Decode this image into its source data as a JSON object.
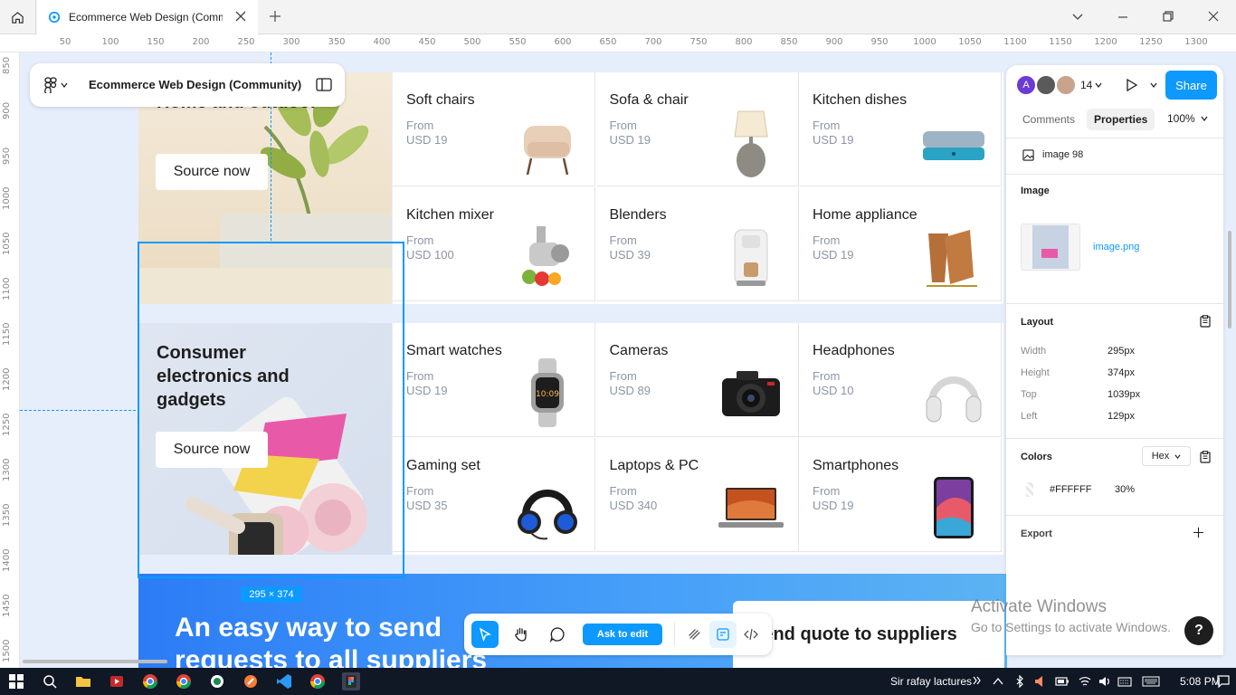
{
  "browser": {
    "tab_title": "Ecommerce Web Design (Community)"
  },
  "ruler_top": [
    "50",
    "100",
    "150",
    "200",
    "250",
    "300",
    "350",
    "400",
    "450",
    "500",
    "550",
    "600",
    "650",
    "700",
    "750",
    "800",
    "850",
    "900",
    "950",
    "1000",
    "1050",
    "1100",
    "1150",
    "1200",
    "1250",
    "1300"
  ],
  "ruler_left": [
    "850",
    "900",
    "950",
    "1000",
    "1050",
    "1100",
    "1150",
    "1200",
    "1250",
    "1300",
    "1350",
    "1400",
    "1450",
    "1500"
  ],
  "file": {
    "name": "Ecommerce Web Design (Community)"
  },
  "design": {
    "home_title": "Home and outdoor",
    "home_button": "Source now",
    "elec_title": "Consumer electronics and gadgets",
    "elec_button": "Source now",
    "from_label": "From",
    "home_items": [
      {
        "title": "Soft chairs",
        "price": "USD 19",
        "icon": "armchair"
      },
      {
        "title": "Sofa & chair",
        "price": "USD 19",
        "icon": "lamp"
      },
      {
        "title": "Kitchen dishes",
        "price": "USD 19",
        "icon": "air-mattress"
      },
      {
        "title": "Kitchen mixer",
        "price": "USD 100",
        "icon": "juicer"
      },
      {
        "title": "Blenders",
        "price": "USD 39",
        "icon": "coffee-machine"
      },
      {
        "title": "Home appliance",
        "price": "USD 19",
        "icon": "magazine-rack"
      }
    ],
    "elec_items": [
      {
        "title": "Smart watches",
        "price": "USD 19",
        "icon": "smartwatch"
      },
      {
        "title": "Cameras",
        "price": "USD 89",
        "icon": "camera"
      },
      {
        "title": "Headphones",
        "price": "USD 10",
        "icon": "headphones"
      },
      {
        "title": "Gaming set",
        "price": "USD 35",
        "icon": "gaming-headset"
      },
      {
        "title": "Laptops & PC",
        "price": "USD 340",
        "icon": "laptop"
      },
      {
        "title": "Smartphones",
        "price": "USD 19",
        "icon": "tablet"
      }
    ],
    "banner_title": "An easy way to send requests to all suppliers",
    "quote_title": "Send quote to suppliers",
    "selection_size": "295 × 374"
  },
  "toolbar": {
    "ask_label": "Ask to edit"
  },
  "panel": {
    "user_count": "14",
    "avatar_letter": "A",
    "share_label": "Share",
    "tabs": {
      "comments": "Comments",
      "properties": "Properties"
    },
    "zoom": "100%",
    "layer_name": "image 98",
    "image_header": "Image",
    "image_file": "image.png",
    "layout_header": "Layout",
    "layout": [
      {
        "key": "Width",
        "value": "295px"
      },
      {
        "key": "Height",
        "value": "374px"
      },
      {
        "key": "Top",
        "value": "1039px"
      },
      {
        "key": "Left",
        "value": "129px"
      }
    ],
    "colors_header": "Colors",
    "color_format": "Hex",
    "color_hex": "#FFFFFF",
    "color_opacity": "30%",
    "export_header": "Export"
  },
  "watermark": {
    "line1": "Activate Windows",
    "line2": "Go to Settings to activate Windows."
  },
  "taskbar": {
    "notification_text": "Sir rafay lactures",
    "time": "5:08 PM"
  },
  "colors": {
    "accent": "#0d99ff",
    "banner": "#2c7cf6",
    "text_muted": "#8b96a5"
  }
}
